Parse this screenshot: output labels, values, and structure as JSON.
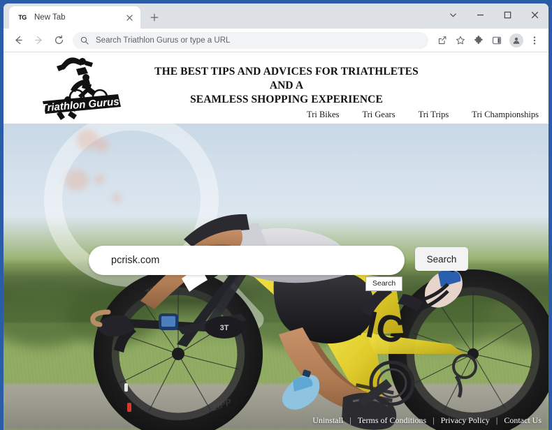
{
  "browser": {
    "tab": {
      "favicon_text": "TG",
      "title": "New Tab",
      "close_icon": "close-icon"
    },
    "new_tab_label": "+",
    "window_controls": {
      "menu": "chevron-down-icon",
      "minimize": "minimize-icon",
      "maximize": "maximize-icon",
      "close": "close-icon"
    },
    "toolbar": {
      "back": "back-arrow-icon",
      "forward": "forward-arrow-icon",
      "reload": "reload-icon",
      "omnibox_icon": "search-icon",
      "omnibox_placeholder": "Search Triathlon Gurus or type a URL",
      "omnibox_value": "",
      "share": "share-icon",
      "bookmark": "star-icon",
      "extensions": "puzzle-icon",
      "sidepanel": "side-panel-icon",
      "profile": "profile-avatar-icon",
      "menu": "three-dot-menu-icon"
    }
  },
  "site": {
    "logo_text": "Triathlon Gurus",
    "headline_line1": "THE BEST TIPS AND ADVICES FOR TRIATHLETES",
    "headline_line2": "AND A",
    "headline_line3": "SEAMLESS SHOPPING EXPERIENCE",
    "nav": [
      {
        "label": "Tri Bikes"
      },
      {
        "label": "Tri Gears"
      },
      {
        "label": "Tri Trips"
      },
      {
        "label": "Tri Championships"
      }
    ],
    "search": {
      "value": "pcrisk.com",
      "placeholder": "",
      "button_label": "Search",
      "tooltip_label": "Search"
    },
    "footer": [
      {
        "label": "Uninstall"
      },
      {
        "label": "Terms of Conditions"
      },
      {
        "label": "Privacy Policy"
      },
      {
        "label": "Contact Us"
      }
    ],
    "separator": "|"
  },
  "colors": {
    "frame_blue": "#2a5ca8",
    "tabstrip": "#dee1e6",
    "omnibox": "#f1f3f4",
    "search_button": "#f3f3f3",
    "bike_yellow": "#e8d43a"
  }
}
